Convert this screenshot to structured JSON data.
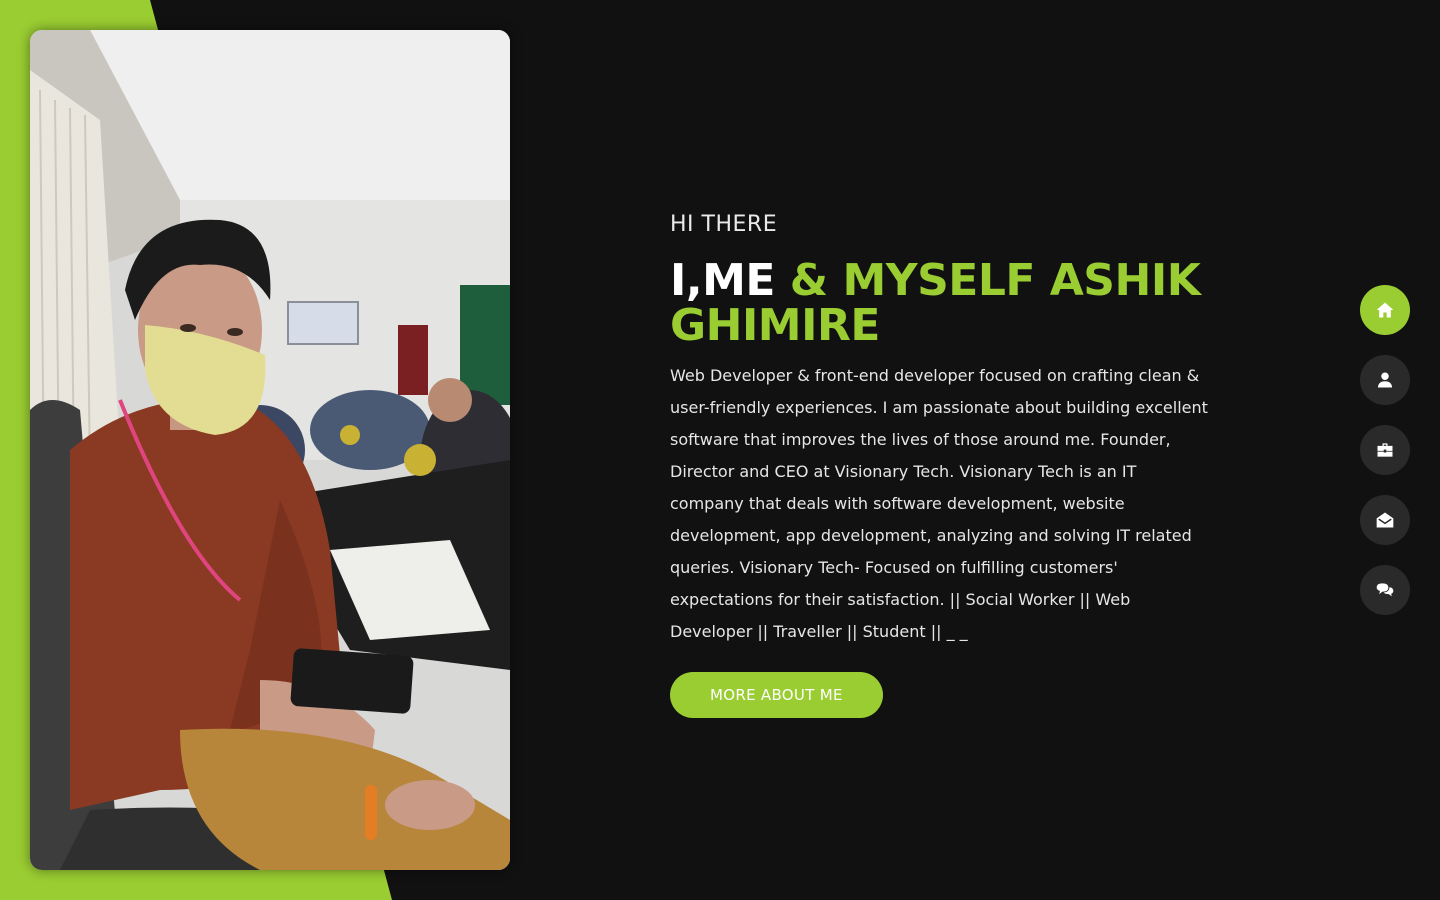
{
  "colors": {
    "accent": "#9acd32",
    "background": "#111111",
    "nav_button": "#2b2a2a",
    "text": "#e6e6e6"
  },
  "hero": {
    "eyebrow": "HI THERE",
    "headline_white": "I,ME",
    "headline_accent": " & MYSELF ASHIK GHIMIRE",
    "bio": "Web Developer & front-end developer focused on crafting clean & user-friendly experiences. I am passionate about building excellent software that improves the lives of those around me. Founder, Director and CEO at Visionary Tech. Visionary Tech is an IT company that deals with software development, website development, app development, analyzing and solving IT related queries. Visionary Tech- Focused on fulfilling customers' expectations for their satisfaction. || Social Worker || Web Developer || Traveller || Student ||     _           _",
    "cta_label": "MORE ABOUT ME"
  },
  "side_nav": {
    "items": [
      {
        "icon": "home-icon",
        "active": true
      },
      {
        "icon": "user-icon",
        "active": false
      },
      {
        "icon": "briefcase-icon",
        "active": false
      },
      {
        "icon": "envelope-open-icon",
        "active": false
      },
      {
        "icon": "comments-icon",
        "active": false
      }
    ]
  }
}
